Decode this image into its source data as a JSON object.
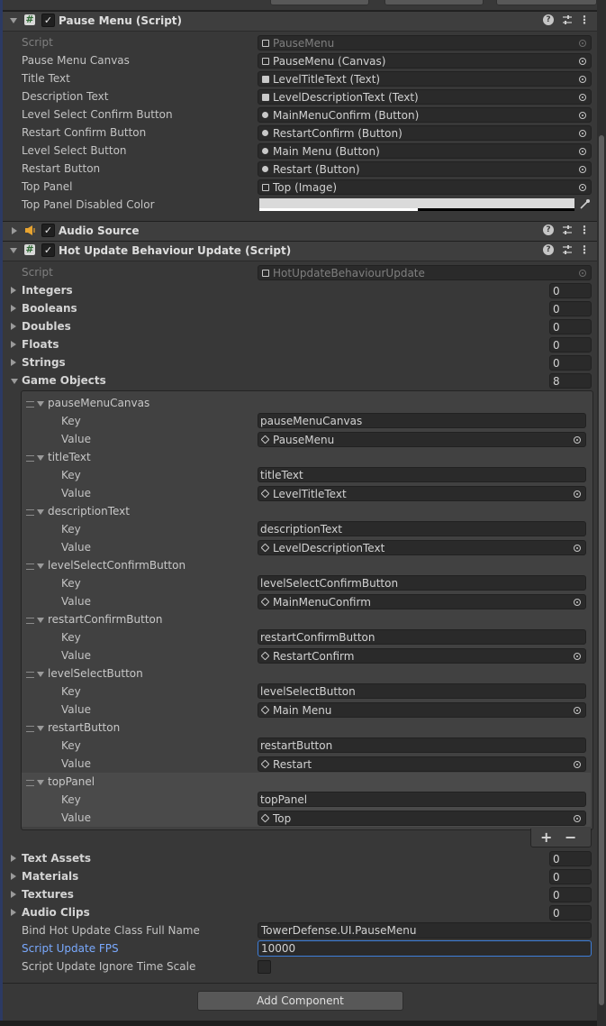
{
  "pause_menu": {
    "header_title": "Pause Menu (Script)",
    "rows": [
      {
        "label": "Script",
        "value": "PauseMenu",
        "icon": "script-icon"
      },
      {
        "label": "Pause Menu Canvas",
        "value": "PauseMenu (Canvas)",
        "icon": "canvas-icon"
      },
      {
        "label": "Title Text",
        "value": "LevelTitleText (Text)",
        "icon": "text-icon"
      },
      {
        "label": "Description Text",
        "value": "LevelDescriptionText (Text)",
        "icon": "text-icon"
      },
      {
        "label": "Level Select Confirm Button",
        "value": "MainMenuConfirm (Button)",
        "icon": "button-icon"
      },
      {
        "label": "Restart Confirm Button",
        "value": "RestartConfirm (Button)",
        "icon": "button-icon"
      },
      {
        "label": "Level Select Button",
        "value": "Main Menu (Button)",
        "icon": "button-icon"
      },
      {
        "label": "Restart Button",
        "value": "Restart (Button)",
        "icon": "button-icon"
      },
      {
        "label": "Top Panel",
        "value": "Top (Image)",
        "icon": "image-icon"
      }
    ],
    "color_label": "Top Panel Disabled Color",
    "color_value": "#dadada",
    "color_alpha": 0.5
  },
  "audio_source": {
    "header_title": "Audio Source"
  },
  "hot_update": {
    "header_title": "Hot Update Behaviour Update (Script)",
    "script_label": "Script",
    "script_value": "HotUpdateBehaviourUpdate",
    "collapsed_sections_top": [
      {
        "label": "Integers",
        "count": "0"
      },
      {
        "label": "Booleans",
        "count": "0"
      },
      {
        "label": "Doubles",
        "count": "0"
      },
      {
        "label": "Floats",
        "count": "0"
      },
      {
        "label": "Strings",
        "count": "0"
      }
    ],
    "game_objects": {
      "label": "Game Objects",
      "count": "8",
      "key_label": "Key",
      "value_label": "Value",
      "items": [
        {
          "name": "pauseMenuCanvas",
          "key": "pauseMenuCanvas",
          "value": "PauseMenu"
        },
        {
          "name": "titleText",
          "key": "titleText",
          "value": "LevelTitleText"
        },
        {
          "name": "descriptionText",
          "key": "descriptionText",
          "value": "LevelDescriptionText"
        },
        {
          "name": "levelSelectConfirmButton",
          "key": "levelSelectConfirmButton",
          "value": "MainMenuConfirm"
        },
        {
          "name": "restartConfirmButton",
          "key": "restartConfirmButton",
          "value": "RestartConfirm"
        },
        {
          "name": "levelSelectButton",
          "key": "levelSelectButton",
          "value": "Main Menu"
        },
        {
          "name": "restartButton",
          "key": "restartButton",
          "value": "Restart"
        },
        {
          "name": "topPanel",
          "key": "topPanel",
          "value": "Top"
        }
      ],
      "add_symbol": "+",
      "remove_symbol": "−"
    },
    "collapsed_sections_bottom": [
      {
        "label": "Text Assets",
        "count": "0"
      },
      {
        "label": "Materials",
        "count": "0"
      },
      {
        "label": "Textures",
        "count": "0"
      },
      {
        "label": "Audio Clips",
        "count": "0"
      }
    ],
    "bind_class_label": "Bind Hot Update Class Full Name",
    "bind_class_value": "TowerDefense.UI.PauseMenu",
    "fps_label": "Script Update FPS",
    "fps_value": "10000",
    "ignore_time_scale_label": "Script Update Ignore Time Scale",
    "ignore_time_scale_checked": false
  },
  "add_component_label": "Add Component",
  "header_icons": {
    "help": "?",
    "menu": "⋮",
    "check": "✓",
    "script_hash": "#"
  }
}
